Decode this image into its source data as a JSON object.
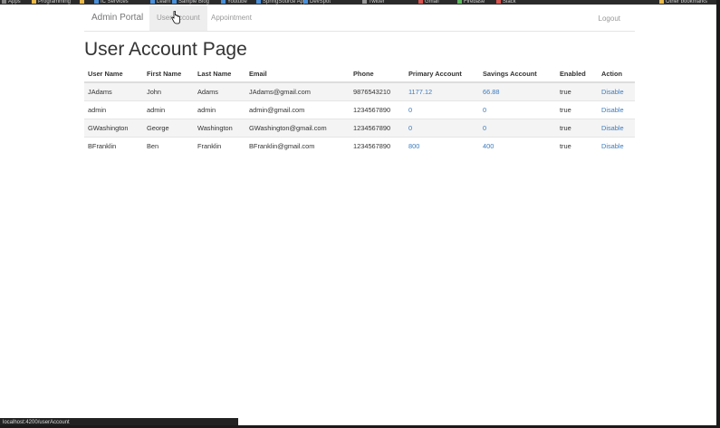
{
  "bookmarks": {
    "items": [
      {
        "label": "Apps",
        "color": "#888888"
      },
      {
        "label": "Programming",
        "color": "#e9b949"
      },
      {
        "label": "",
        "color": "#e9b949"
      },
      {
        "label": "IC Services",
        "color": "#4a90d9"
      },
      {
        "label": "Learn",
        "color": "#4a90d9"
      },
      {
        "label": "Sample Blog",
        "color": "#4a90d9"
      },
      {
        "label": "Youtube",
        "color": "#4a90d9"
      },
      {
        "label": "SpringSource App",
        "color": "#4a90d9"
      },
      {
        "label": "DevSpot",
        "color": "#4a90d9"
      },
      {
        "label": "Twitter",
        "color": "#999999"
      },
      {
        "label": "Gmail",
        "color": "#d9534f"
      },
      {
        "label": "Firebase",
        "color": "#5cb85c"
      },
      {
        "label": "Slack",
        "color": "#d9534f"
      },
      {
        "label": "Other bookmarks",
        "color": "#e9b949"
      }
    ]
  },
  "navbar": {
    "brand": "Admin Portal",
    "user_account": "User Account",
    "appointment": "Appointment",
    "logout": "Logout"
  },
  "page": {
    "title": "User Account Page"
  },
  "table": {
    "headers": [
      "User Name",
      "First Name",
      "Last Name",
      "Email",
      "Phone",
      "Primary Account",
      "Savings Account",
      "Enabled",
      "Action"
    ],
    "rows": [
      [
        "JAdams",
        "John",
        "Adams",
        "JAdams@gmail.com",
        "9876543210",
        "1177.12",
        "66.88",
        "true",
        "Disable"
      ],
      [
        "admin",
        "admin",
        "admin",
        "admin@gmail.com",
        "1234567890",
        "0",
        "0",
        "true",
        "Disable"
      ],
      [
        "GWashington",
        "George",
        "Washington",
        "GWashington@gmail.com",
        "1234567890",
        "0",
        "0",
        "true",
        "Disable"
      ],
      [
        "BFranklin",
        "Ben",
        "Franklin",
        "BFranklin@gmail.com",
        "1234567890",
        "800",
        "400",
        "true",
        "Disable"
      ]
    ]
  },
  "status_bar": {
    "url": "localhost:4200/userAccount"
  }
}
